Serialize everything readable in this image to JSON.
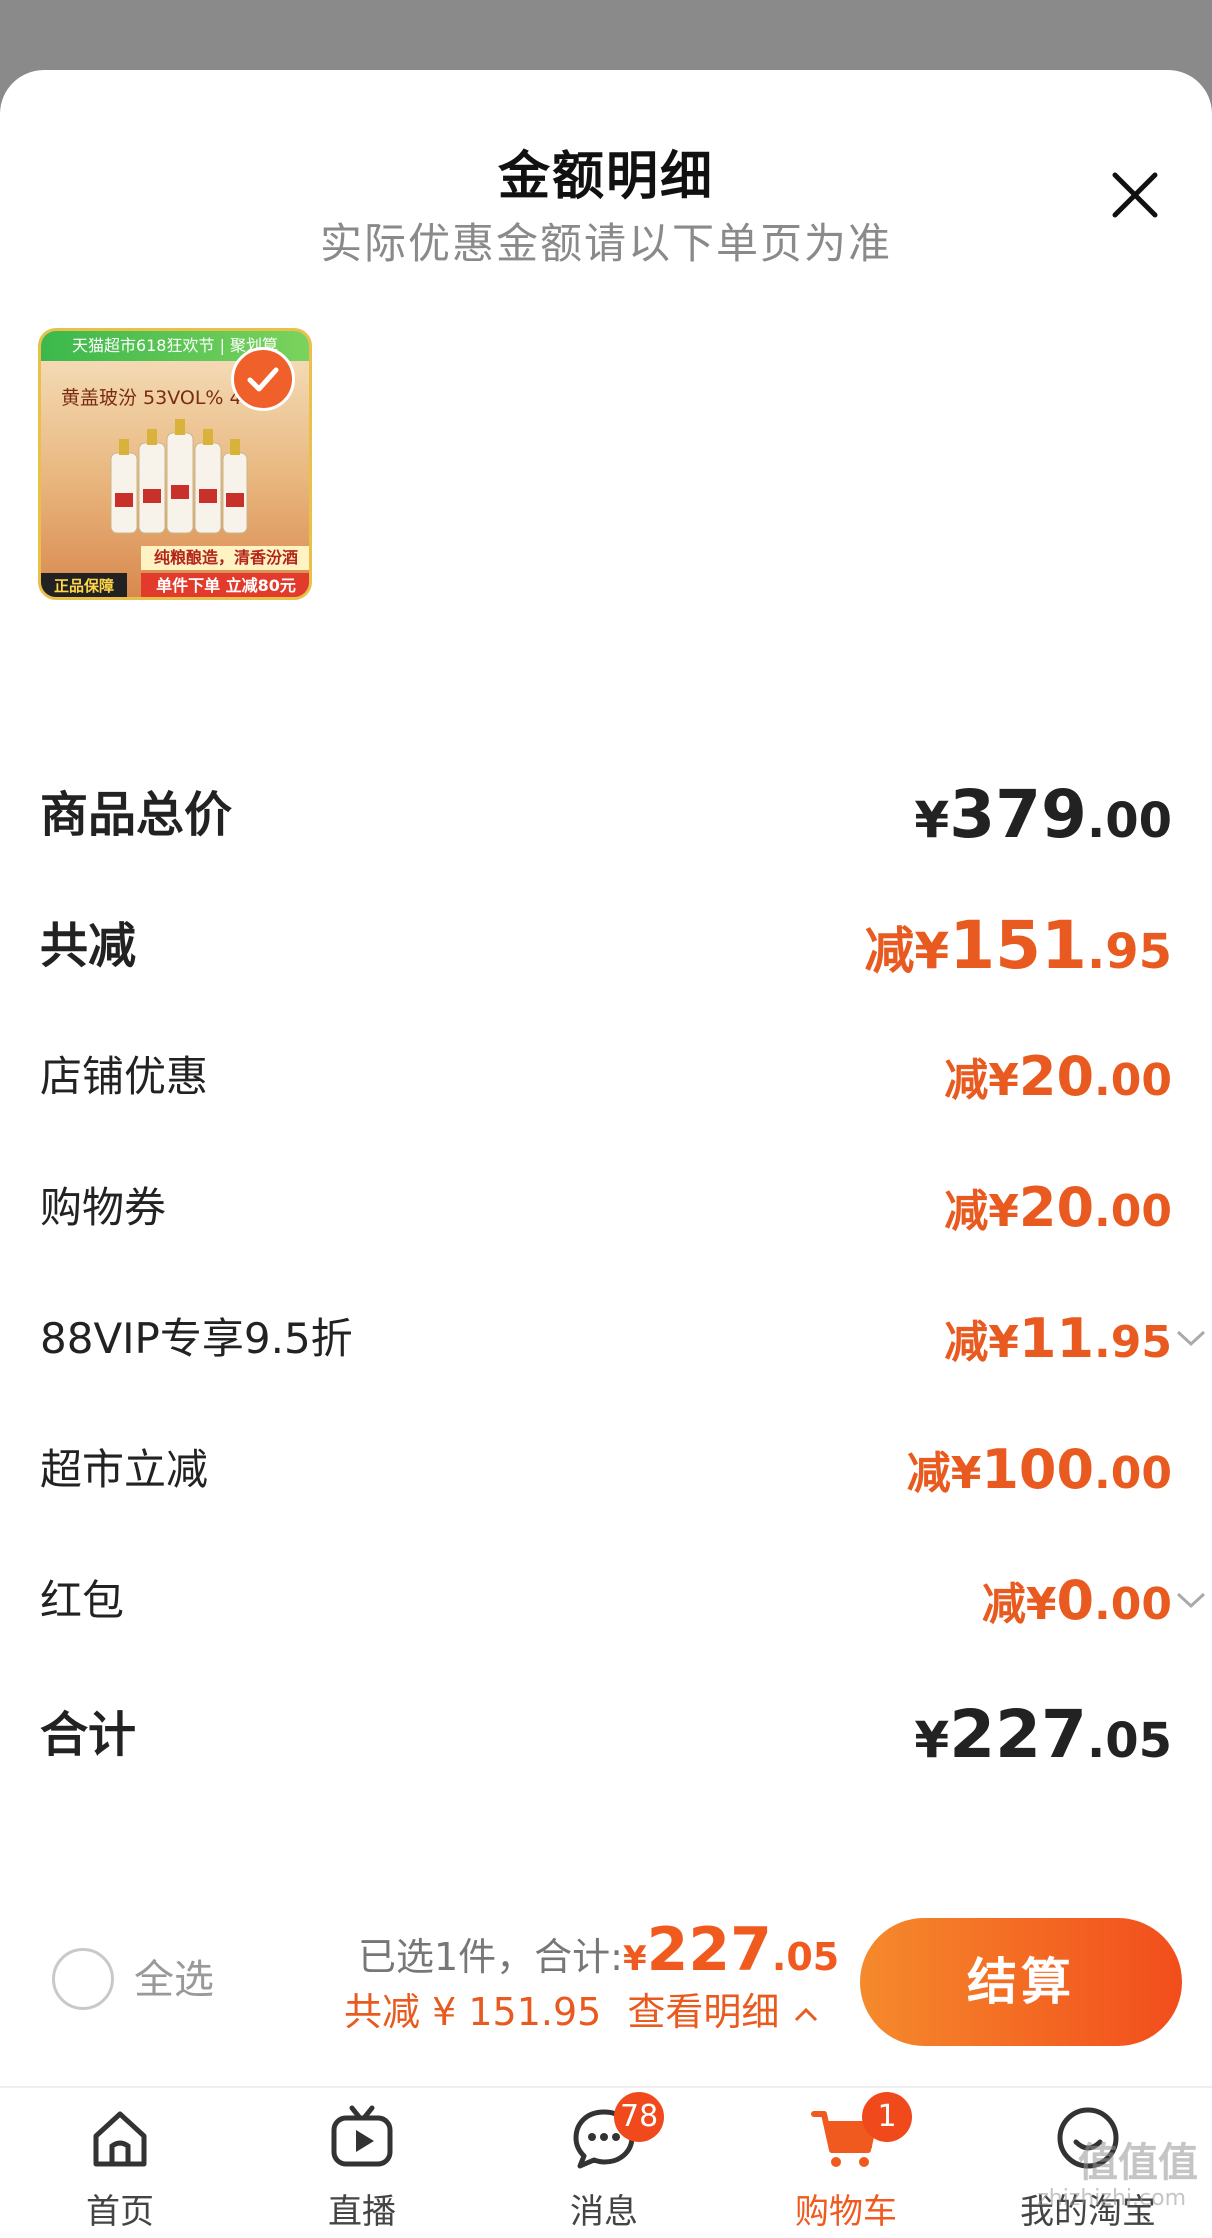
{
  "header": {
    "title": "金额明细",
    "subtitle": "实际优惠金额请以下单页为准"
  },
  "product": {
    "top_banner": "天猫超市618狂欢节 | 聚划算",
    "name": "黄盖玻汾 53VOL% 475",
    "slogan": "纯粮酿造，清香汾酒",
    "promo": "单件下单 立减80元",
    "guarantee": "正品保障",
    "selected": true
  },
  "breakdown": [
    {
      "label": "商品总价",
      "prefix": "",
      "currency": "¥",
      "int": "379",
      "dec": ".00",
      "style": "total",
      "chevron": false
    },
    {
      "label": "共减",
      "prefix": "减",
      "currency": "¥",
      "int": "151",
      "dec": ".95",
      "style": "discount-big",
      "chevron": false
    },
    {
      "label": "店铺优惠",
      "prefix": "减",
      "currency": "¥",
      "int": "20",
      "dec": ".00",
      "style": "discount",
      "chevron": false
    },
    {
      "label": "购物券",
      "prefix": "减",
      "currency": "¥",
      "int": "20",
      "dec": ".00",
      "style": "discount",
      "chevron": false
    },
    {
      "label": "88VIP专享9.5折",
      "prefix": "减",
      "currency": "¥",
      "int": "11",
      "dec": ".95",
      "style": "discount",
      "chevron": true
    },
    {
      "label": "超市立减",
      "prefix": "减",
      "currency": "¥",
      "int": "100",
      "dec": ".00",
      "style": "discount",
      "chevron": false
    },
    {
      "label": "红包",
      "prefix": "减",
      "currency": "¥",
      "int": "0",
      "dec": ".00",
      "style": "discount",
      "chevron": true
    },
    {
      "label": "合计",
      "prefix": "",
      "currency": "¥",
      "int": "227",
      "dec": ".05",
      "style": "total",
      "chevron": false
    }
  ],
  "footer": {
    "select_all": "全选",
    "selected_text": "已选1件，合计:",
    "total_currency": "¥",
    "total_int": "227",
    "total_dec": ".05",
    "saved_text": "共减 ¥ 151.95",
    "detail_link": "查看明细",
    "checkout": "结算"
  },
  "tabs": [
    {
      "label": "首页",
      "icon": "home-icon",
      "badge": ""
    },
    {
      "label": "直播",
      "icon": "live-icon",
      "badge": ""
    },
    {
      "label": "消息",
      "icon": "message-icon",
      "badge": "78"
    },
    {
      "label": "购物车",
      "icon": "cart-icon",
      "badge": "1",
      "active": true
    },
    {
      "label": "我的淘宝",
      "icon": "profile-icon",
      "badge": ""
    }
  ],
  "watermark": {
    "text": "值值值",
    "sub": "zhizhizhi.com"
  },
  "colors": {
    "accent": "#f05a1f",
    "discount": "#e85a1f",
    "text": "#222222",
    "muted": "#8a8a8a"
  }
}
